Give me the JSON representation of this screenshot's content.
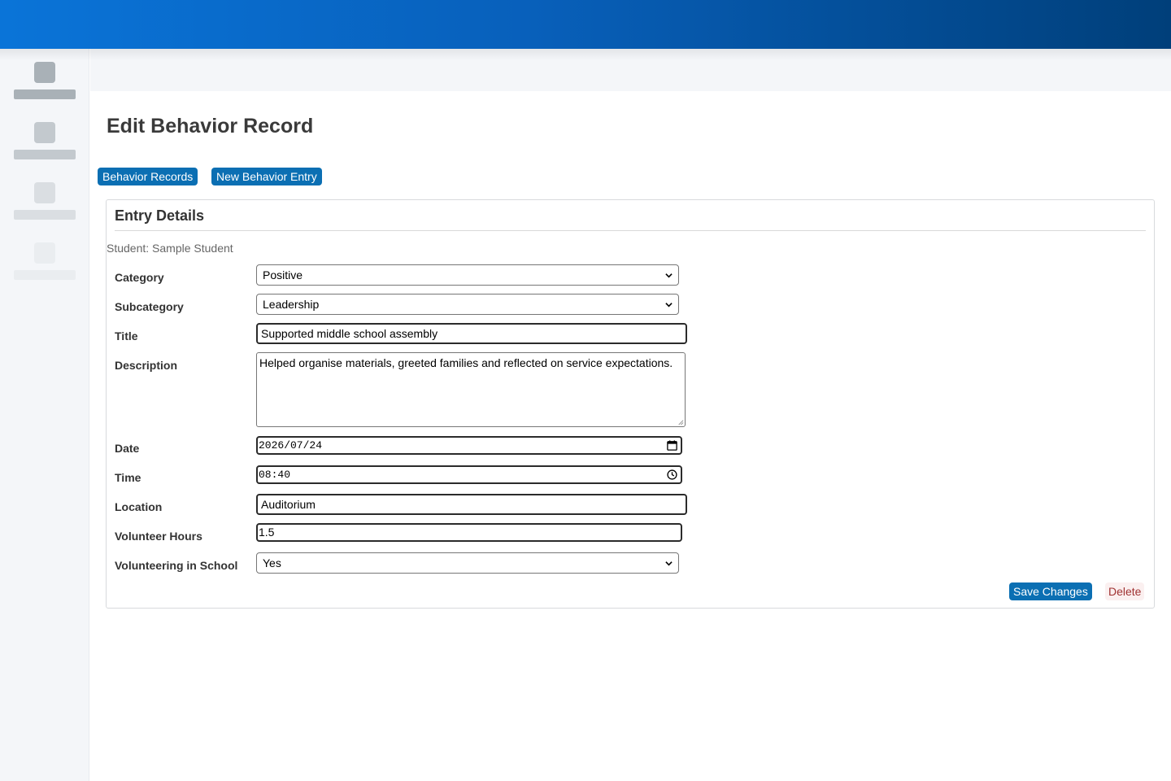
{
  "page": {
    "title": "Edit Behavior Record"
  },
  "nav": {
    "behavior_records_label": "Behavior Records",
    "new_entry_label": "New Behavior Entry"
  },
  "card": {
    "title": "Entry Details",
    "student_line": "Student: Sample Student"
  },
  "form": {
    "category": {
      "label": "Category",
      "value": "Positive"
    },
    "subcategory": {
      "label": "Subcategory",
      "value": "Leadership"
    },
    "title": {
      "label": "Title",
      "value": "Supported middle school assembly"
    },
    "description": {
      "label": "Description",
      "value": "Helped organise materials, greeted families and reflected on service expectations."
    },
    "date": {
      "label": "Date",
      "value": "2026/07/24"
    },
    "time": {
      "label": "Time",
      "value": "08:40"
    },
    "location": {
      "label": "Location",
      "value": "Auditorium"
    },
    "volunteer_hours": {
      "label": "Volunteer Hours",
      "value": "1.5"
    },
    "volunteering_in_school": {
      "label": "Volunteering in School",
      "value": "Yes"
    }
  },
  "actions": {
    "save_label": "Save Changes",
    "delete_label": "Delete"
  },
  "colors": {
    "primary": "#0b6fb3",
    "header_start": "#0a74d8",
    "header_end": "#003f7a",
    "danger": "#a03232"
  }
}
